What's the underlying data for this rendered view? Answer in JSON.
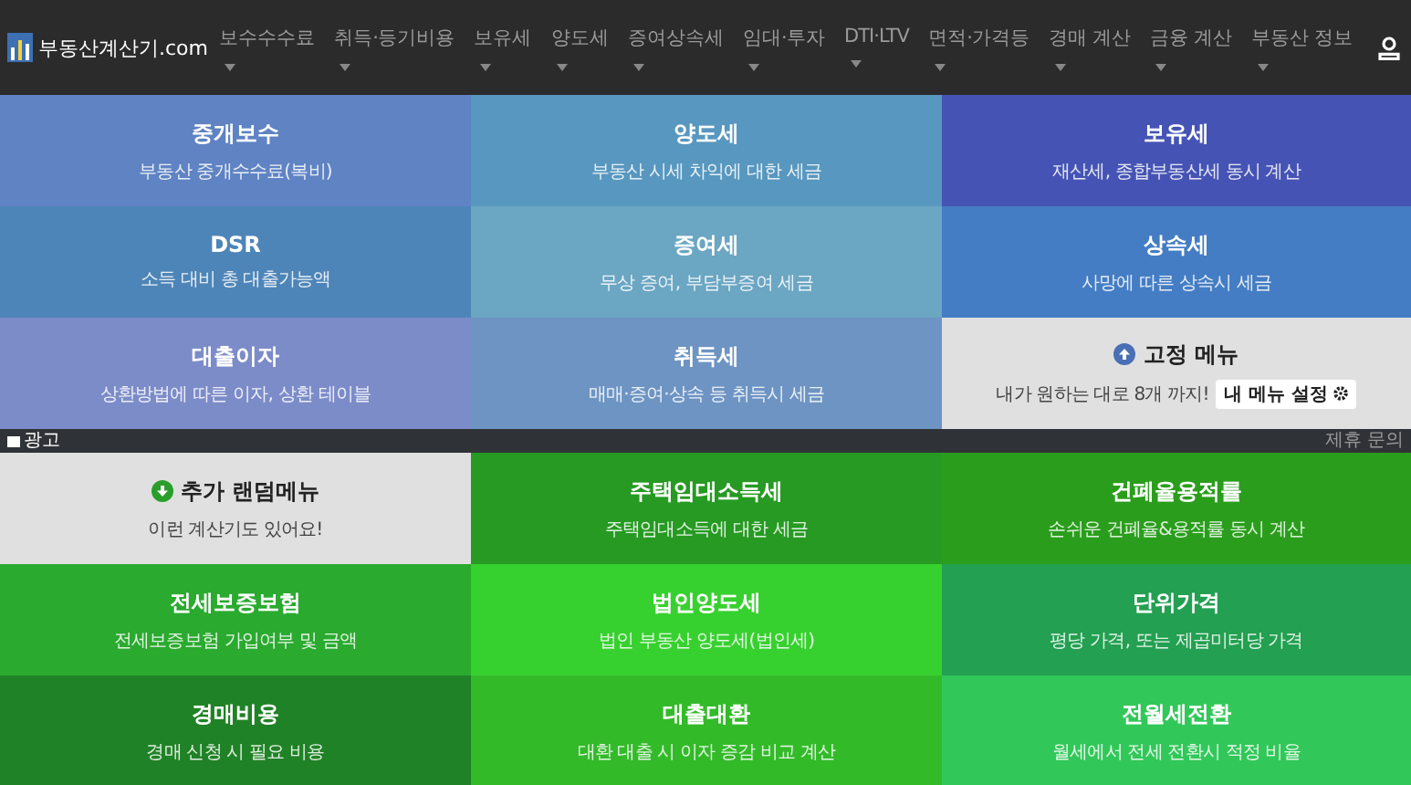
{
  "header": {
    "logo": "부동산계산기.com",
    "nav_items": [
      {
        "label": "보수수수료",
        "dropdown": true
      },
      {
        "label": "취득·등기비용",
        "dropdown": true
      },
      {
        "label": "보유세",
        "dropdown": true
      },
      {
        "label": "양도세",
        "dropdown": true
      },
      {
        "label": "증여상속세",
        "dropdown": true
      },
      {
        "label": "임대·투자",
        "dropdown": true
      },
      {
        "label": "DTI·LTV",
        "dropdown": true
      },
      {
        "label": "면적·가격등",
        "dropdown": true
      },
      {
        "label": "경매 계산",
        "dropdown": true
      },
      {
        "label": "금융 계산",
        "dropdown": true
      },
      {
        "label": "부동산 정보",
        "dropdown": true
      }
    ]
  },
  "top_tiles": [
    {
      "kind": "calc",
      "title": "중개보수",
      "subtitle": "부동산 중개수수료(복비)",
      "color": "#5f83c3"
    },
    {
      "kind": "calc",
      "title": "양도세",
      "subtitle": "부동산 시세 차익에 대한 세금",
      "color": "#5897bf"
    },
    {
      "kind": "calc",
      "title": "보유세",
      "subtitle": "재산세, 종합부동산세 동시 계산",
      "color": "#4554b4"
    },
    {
      "kind": "calc",
      "title": "DSR",
      "subtitle": "소득 대비 총 대출가능액",
      "color": "#4e85b8"
    },
    {
      "kind": "calc",
      "title": "증여세",
      "subtitle": "무상 증여, 부담부증여 세금",
      "color": "#6ba6c3"
    },
    {
      "kind": "calc",
      "title": "상속세",
      "subtitle": "사망에 따른 상속시 세금",
      "color": "#447dc3"
    },
    {
      "kind": "calc",
      "title": "대출이자",
      "subtitle": "상환방법에 따른 이자, 상환 테이블",
      "color": "#7c8cc9"
    },
    {
      "kind": "calc",
      "title": "취득세",
      "subtitle": "매매·증여·상속 등 취득시 세금",
      "color": "#6d94c3"
    },
    {
      "kind": "pinned",
      "title": "고정 메뉴",
      "subtitle": "내가 원하는 대로 8개 까지!",
      "button": "내 메뉴 설정",
      "color": "#e0e0e0"
    }
  ],
  "ad_bar": {
    "label": "광고",
    "link": "제휴 문의"
  },
  "bottom_tiles": [
    {
      "kind": "random",
      "title": "추가 랜덤메뉴",
      "subtitle": "이런 계산기도 있어요!",
      "color": "#e0e0e0"
    },
    {
      "kind": "calc",
      "title": "주택임대소득세",
      "subtitle": "주택임대소득에 대한 세금",
      "color": "#269a22"
    },
    {
      "kind": "calc",
      "title": "건폐율용적률",
      "subtitle": "손쉬운 건폐율&용적률 동시 계산",
      "color": "#2a9e1c"
    },
    {
      "kind": "calc",
      "title": "전세보증보험",
      "subtitle": "전세보증보험 가입여부 및 금액",
      "color": "#2aaa2f"
    },
    {
      "kind": "calc",
      "title": "법인양도세",
      "subtitle": "법인 부동산 양도세(법인세)",
      "color": "#37d12f"
    },
    {
      "kind": "calc",
      "title": "단위가격",
      "subtitle": "평당 가격, 또는 제곱미터당 가격",
      "color": "#23a051"
    },
    {
      "kind": "calc",
      "title": "경매비용",
      "subtitle": "경매 신청 시 필요 비용",
      "color": "#208226"
    },
    {
      "kind": "calc",
      "title": "대출대환",
      "subtitle": "대환 대출 시 이자 증감 비교 계산",
      "color": "#33ba29"
    },
    {
      "kind": "calc",
      "title": "전월세전환",
      "subtitle": "월세에서 전세 전환시 적정 비율",
      "color": "#31c859"
    }
  ]
}
